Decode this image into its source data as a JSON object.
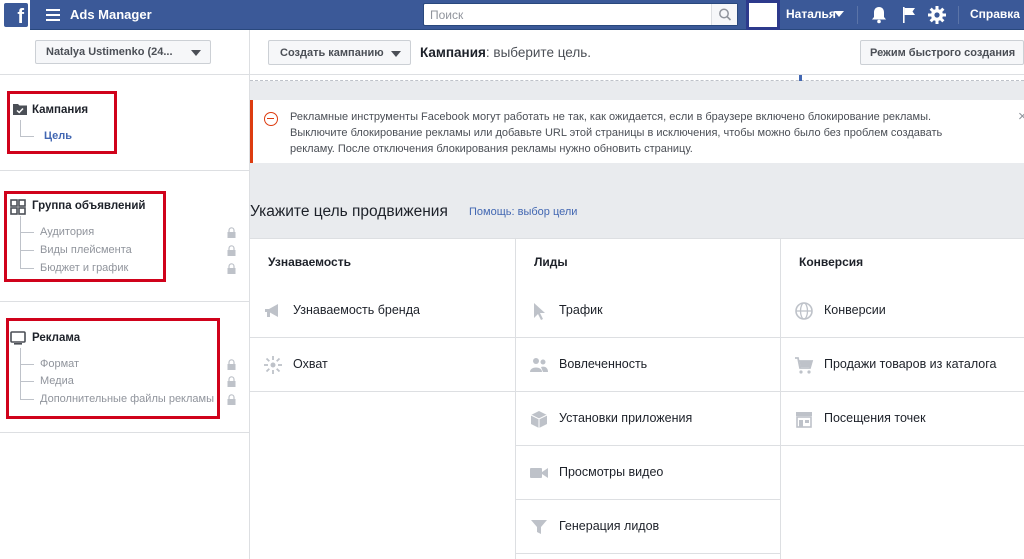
{
  "topbar": {
    "logo": "f",
    "app_title": "Ads Manager",
    "search_placeholder": "Поиск",
    "user_name": "Наталья",
    "help": "Справка"
  },
  "sidebar": {
    "account": "Natalya Ustimenko (24...",
    "campaign": {
      "title": "Кампания",
      "items": [
        "Цель"
      ]
    },
    "adset": {
      "title": "Группа объявлений",
      "items": [
        "Аудитория",
        "Виды плейсмента",
        "Бюджет и график"
      ]
    },
    "ad": {
      "title": "Реклама",
      "items": [
        "Формат",
        "Медиа",
        "Дополнительные файлы рекламы"
      ]
    }
  },
  "header": {
    "create_button": "Создать кампанию",
    "title_bold": "Кампания",
    "title_rest": ": выберите цель.",
    "quick_button": "Режим быстрого создания"
  },
  "alert": {
    "text": "Рекламные инструменты Facebook могут работать не так, как ожидается, если в браузере включено блокирование рекламы. Выключите блокирование рекламы или добавьте URL этой страницы в исключения, чтобы можно было без проблем создавать рекламу. После отключения блокирования рекламы нужно обновить страницу."
  },
  "goal": {
    "heading": "Укажите цель продвижения",
    "help_link": "Помощь: выбор цели"
  },
  "columns": [
    {
      "title": "Узнаваемость",
      "items": [
        {
          "label": "Узнаваемость бренда",
          "icon": "megaphone-icon"
        },
        {
          "label": "Охват",
          "icon": "burst-icon"
        }
      ]
    },
    {
      "title": "Лиды",
      "items": [
        {
          "label": "Трафик",
          "icon": "cursor-icon"
        },
        {
          "label": "Вовлеченность",
          "icon": "people-icon"
        },
        {
          "label": "Установки приложения",
          "icon": "box-icon"
        },
        {
          "label": "Просмотры видео",
          "icon": "video-camera-icon"
        },
        {
          "label": "Генерация лидов",
          "icon": "funnel-icon"
        }
      ]
    },
    {
      "title": "Конверсия",
      "items": [
        {
          "label": "Конверсии",
          "icon": "globe-icon"
        },
        {
          "label": "Продажи товаров из каталога",
          "icon": "cart-icon"
        },
        {
          "label": "Посещения точек",
          "icon": "store-icon"
        }
      ]
    }
  ],
  "colors": {
    "brand": "#3b5998",
    "link": "#4267b2",
    "highlight": "#d0021b",
    "alert": "#dd3c10"
  }
}
